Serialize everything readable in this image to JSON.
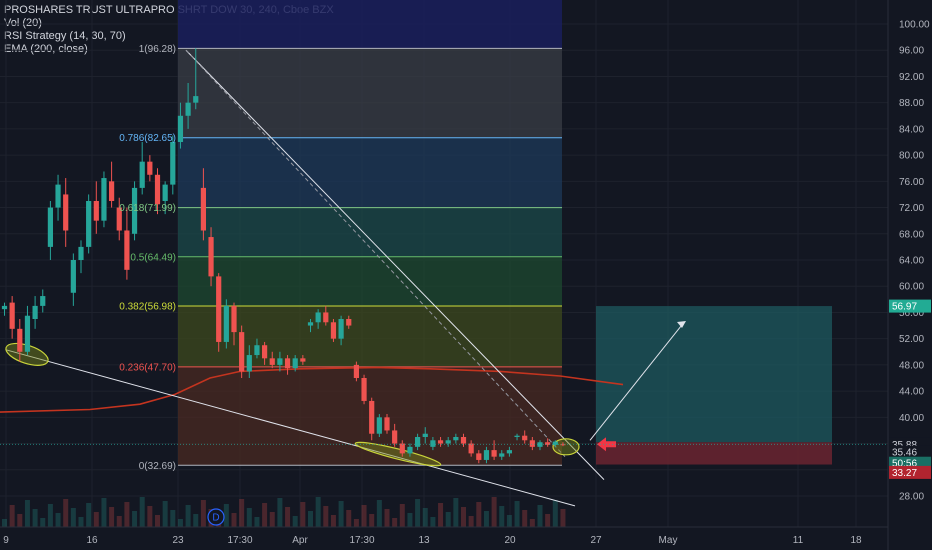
{
  "legend": {
    "title": "PROSHARES TRUST ULTRAPRO SHRT DOW 30, 240, Cboe BZX",
    "vol": "Vol (20)",
    "rsi": "RSI Strategy (14, 30, 70)",
    "ema": "EMA (200, close)"
  },
  "colors": {
    "background": "#131722",
    "up": "#26a69a",
    "down": "#ef5350",
    "ema": "#c4341f",
    "trendline": "#e0e3eb",
    "ellipse": "#c9d43a",
    "arrow": "#f23645",
    "target_zone": "#1e5a5f",
    "stop_zone": "#6b2530"
  },
  "chart_data": {
    "type": "candlestick",
    "ylim": [
      26,
      102
    ],
    "y_ticks": [
      "100.00",
      "96.00",
      "92.00",
      "88.00",
      "84.00",
      "80.00",
      "76.00",
      "72.00",
      "68.00",
      "64.00",
      "60.00",
      "56.00",
      "52.00",
      "48.00",
      "44.00",
      "40.00",
      "36.00",
      "32.00",
      "28.00"
    ],
    "x_ticks": [
      "9",
      "16",
      "23",
      "17:30",
      "Apr",
      "17:30",
      "13",
      "20",
      "27",
      "May",
      "11",
      "18"
    ],
    "fib_levels": [
      {
        "ratio": "1",
        "value": 96.28,
        "label": "1(96.28)",
        "color": "#b2b5be"
      },
      {
        "ratio": "0.786",
        "value": 82.65,
        "label": "0.786(82.65)",
        "color": "#64b5f6"
      },
      {
        "ratio": "0.618",
        "value": 71.99,
        "label": "0.618(71.99)",
        "color": "#81c784"
      },
      {
        "ratio": "0.5",
        "value": 64.49,
        "label": "0.5(64.49)",
        "color": "#66bb6a"
      },
      {
        "ratio": "0.382",
        "value": 56.98,
        "label": "0.382(56.98)",
        "color": "#cddc39"
      },
      {
        "ratio": "0.236",
        "value": 47.7,
        "label": "0.236(47.70)",
        "color": "#ef5350"
      },
      {
        "ratio": "0",
        "value": 32.69,
        "label": "0(32.69)",
        "color": "#b2b5be"
      }
    ],
    "candles": [
      {
        "o": 56.5,
        "h": 57.5,
        "l": 55.5,
        "c": 57.0
      },
      {
        "o": 57.5,
        "h": 58.5,
        "l": 52.0,
        "c": 53.5
      },
      {
        "o": 53.5,
        "h": 55.0,
        "l": 48.5,
        "c": 50.0
      },
      {
        "o": 50.0,
        "h": 57.0,
        "l": 49.5,
        "c": 55.5
      },
      {
        "o": 55.0,
        "h": 58.5,
        "l": 53.5,
        "c": 57.0
      },
      {
        "o": 57.0,
        "h": 59.5,
        "l": 56.0,
        "c": 58.5
      },
      {
        "o": 66.0,
        "h": 73.0,
        "l": 64.0,
        "c": 72.0
      },
      {
        "o": 72.0,
        "h": 77.0,
        "l": 70.0,
        "c": 75.5
      },
      {
        "o": 74.0,
        "h": 76.5,
        "l": 66.0,
        "c": 68.5
      },
      {
        "o": 59.0,
        "h": 65.0,
        "l": 57.0,
        "c": 64.0
      },
      {
        "o": 64.0,
        "h": 67.0,
        "l": 62.0,
        "c": 66.0
      },
      {
        "o": 66.0,
        "h": 74.0,
        "l": 65.0,
        "c": 73.0
      },
      {
        "o": 73.0,
        "h": 76.0,
        "l": 68.0,
        "c": 70.0
      },
      {
        "o": 70.0,
        "h": 77.5,
        "l": 69.0,
        "c": 76.5
      },
      {
        "o": 76.0,
        "h": 79.0,
        "l": 72.0,
        "c": 73.0
      },
      {
        "o": 72.0,
        "h": 73.5,
        "l": 67.0,
        "c": 68.5
      },
      {
        "o": 68.5,
        "h": 72.0,
        "l": 61.0,
        "c": 62.5
      },
      {
        "o": 68.0,
        "h": 76.0,
        "l": 67.0,
        "c": 75.0
      },
      {
        "o": 75.0,
        "h": 82.0,
        "l": 74.0,
        "c": 79.0
      },
      {
        "o": 79.0,
        "h": 80.0,
        "l": 76.0,
        "c": 77.0
      },
      {
        "o": 77.0,
        "h": 78.0,
        "l": 71.0,
        "c": 72.5
      },
      {
        "o": 73.0,
        "h": 76.0,
        "l": 71.0,
        "c": 75.5
      },
      {
        "o": 75.5,
        "h": 83.0,
        "l": 74.0,
        "c": 82.0
      },
      {
        "o": 82.0,
        "h": 88.0,
        "l": 81.0,
        "c": 86.0
      },
      {
        "o": 86.0,
        "h": 91.0,
        "l": 84.0,
        "c": 88.0
      },
      {
        "o": 88.0,
        "h": 96.3,
        "l": 87.0,
        "c": 89.0
      },
      {
        "o": 75.0,
        "h": 78.0,
        "l": 67.0,
        "c": 68.5
      },
      {
        "o": 67.5,
        "h": 69.0,
        "l": 60.0,
        "c": 61.5
      },
      {
        "o": 61.5,
        "h": 62.0,
        "l": 50.0,
        "c": 51.5
      },
      {
        "o": 51.5,
        "h": 58.0,
        "l": 50.5,
        "c": 57.0
      },
      {
        "o": 57.0,
        "h": 57.5,
        "l": 51.0,
        "c": 53.0
      },
      {
        "o": 53.0,
        "h": 54.0,
        "l": 46.0,
        "c": 47.0
      },
      {
        "o": 47.0,
        "h": 51.0,
        "l": 46.0,
        "c": 49.5
      },
      {
        "o": 49.5,
        "h": 52.0,
        "l": 49.0,
        "c": 51.0
      },
      {
        "o": 51.0,
        "h": 51.5,
        "l": 48.0,
        "c": 49.0
      },
      {
        "o": 49.0,
        "h": 50.0,
        "l": 47.5,
        "c": 48.0
      },
      {
        "o": 48.0,
        "h": 50.0,
        "l": 47.0,
        "c": 49.0
      },
      {
        "o": 49.0,
        "h": 49.5,
        "l": 46.5,
        "c": 47.5
      },
      {
        "o": 47.5,
        "h": 49.5,
        "l": 47.0,
        "c": 49.0
      },
      {
        "o": 49.0,
        "h": 49.5,
        "l": 48.0,
        "c": 48.5
      },
      {
        "o": 54.0,
        "h": 55.0,
        "l": 53.0,
        "c": 54.5
      },
      {
        "o": 54.5,
        "h": 56.5,
        "l": 53.5,
        "c": 56.0
      },
      {
        "o": 56.0,
        "h": 57.0,
        "l": 54.0,
        "c": 54.5
      },
      {
        "o": 54.5,
        "h": 55.0,
        "l": 51.5,
        "c": 52.0
      },
      {
        "o": 52.0,
        "h": 55.5,
        "l": 51.0,
        "c": 55.0
      },
      {
        "o": 55.0,
        "h": 55.5,
        "l": 53.5,
        "c": 54.0
      },
      {
        "o": 48.0,
        "h": 48.5,
        "l": 45.5,
        "c": 46.0
      },
      {
        "o": 46.0,
        "h": 46.5,
        "l": 42.0,
        "c": 42.5
      },
      {
        "o": 42.5,
        "h": 43.0,
        "l": 36.5,
        "c": 37.5
      },
      {
        "o": 37.5,
        "h": 40.5,
        "l": 37.0,
        "c": 40.0
      },
      {
        "o": 40.0,
        "h": 40.5,
        "l": 37.5,
        "c": 38.0
      },
      {
        "o": 38.0,
        "h": 39.0,
        "l": 35.5,
        "c": 36.0
      },
      {
        "o": 36.0,
        "h": 36.5,
        "l": 34.0,
        "c": 34.5
      },
      {
        "o": 34.5,
        "h": 36.0,
        "l": 34.0,
        "c": 35.5
      },
      {
        "o": 35.5,
        "h": 37.5,
        "l": 35.0,
        "c": 37.0
      },
      {
        "o": 37.0,
        "h": 38.5,
        "l": 36.0,
        "c": 37.5
      },
      {
        "o": 35.5,
        "h": 37.0,
        "l": 35.0,
        "c": 36.5
      },
      {
        "o": 36.5,
        "h": 37.0,
        "l": 35.5,
        "c": 36.0
      },
      {
        "o": 36.0,
        "h": 37.0,
        "l": 35.5,
        "c": 36.5
      },
      {
        "o": 36.5,
        "h": 37.5,
        "l": 36.0,
        "c": 37.0
      },
      {
        "o": 37.0,
        "h": 37.5,
        "l": 35.5,
        "c": 36.0
      },
      {
        "o": 36.0,
        "h": 36.5,
        "l": 34.0,
        "c": 34.5
      },
      {
        "o": 34.5,
        "h": 35.0,
        "l": 33.0,
        "c": 33.5
      },
      {
        "o": 33.5,
        "h": 35.5,
        "l": 33.0,
        "c": 35.0
      },
      {
        "o": 35.0,
        "h": 36.5,
        "l": 33.5,
        "c": 34.0
      },
      {
        "o": 34.0,
        "h": 35.0,
        "l": 33.5,
        "c": 34.5
      },
      {
        "o": 34.5,
        "h": 35.5,
        "l": 34.0,
        "c": 35.0
      },
      {
        "o": 37.0,
        "h": 37.5,
        "l": 36.5,
        "c": 37.2
      },
      {
        "o": 37.2,
        "h": 38.0,
        "l": 36.0,
        "c": 36.5
      },
      {
        "o": 36.5,
        "h": 37.0,
        "l": 35.0,
        "c": 35.5
      },
      {
        "o": 35.5,
        "h": 36.5,
        "l": 35.0,
        "c": 36.2
      },
      {
        "o": 36.2,
        "h": 36.8,
        "l": 35.5,
        "c": 35.8
      },
      {
        "o": 35.8,
        "h": 36.5,
        "l": 35.5,
        "c": 36.3
      },
      {
        "o": 35.9,
        "h": 36.2,
        "l": 35.6,
        "c": 35.88
      }
    ],
    "candle_x_start": 4.5,
    "candle_x_step": 7.65,
    "ema_points": [
      [
        0,
        40.8
      ],
      [
        90,
        41.2
      ],
      [
        140,
        42.0
      ],
      [
        175,
        43.5
      ],
      [
        210,
        46.0
      ],
      [
        240,
        47.0
      ],
      [
        300,
        47.4
      ],
      [
        380,
        47.6
      ],
      [
        430,
        47.4
      ],
      [
        500,
        47.0
      ],
      [
        560,
        46.3
      ],
      [
        623,
        45.0
      ]
    ],
    "last_price": "35.88",
    "target_price": "56.97",
    "price_label_2": "35.46",
    "countdown": "50:56",
    "stop_price": "33.27",
    "position": {
      "entry": 36.2,
      "target": 56.97,
      "stop": 32.8
    },
    "event_badge": "D"
  }
}
